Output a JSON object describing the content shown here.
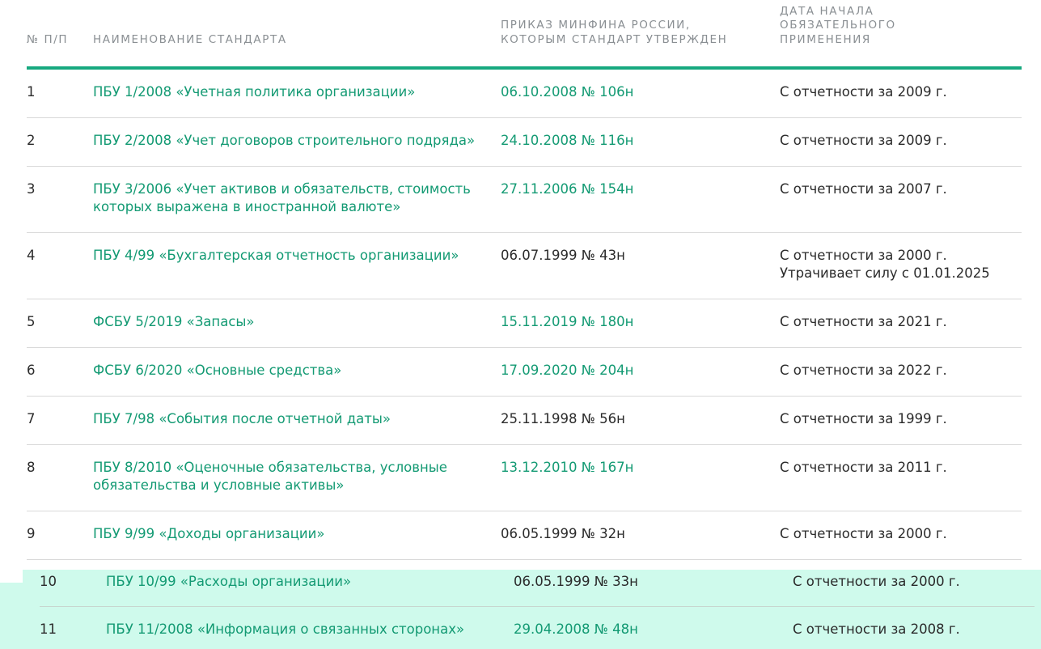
{
  "header": {
    "num": "№ П/П",
    "name": "НАИМЕНОВАНИЕ СТАНДАРТА",
    "order": "ПРИКАЗ МИНФИНА РОССИИ,\nКОТОРЫМ СТАНДАРТ УТВЕРЖДЕН",
    "date": "ДАТА НАЧАЛА\nОБЯЗАТЕЛЬНОГО\nПРИМЕНЕНИЯ"
  },
  "rows": [
    {
      "num": "1",
      "name": "ПБУ 1/2008 «Учетная политика организации»",
      "order": "06.10.2008 № 106н",
      "date": "С отчетности за 2009 г."
    },
    {
      "num": "2",
      "name": "ПБУ 2/2008 «Учет договоров строительного подряда»",
      "order": "24.10.2008 № 116н",
      "date": "С отчетности за 2009 г."
    },
    {
      "num": "3",
      "name": "ПБУ 3/2006 «Учет активов и обязательств, стоимость которых выражена в иностранной валюте»",
      "order": "27.11.2006 № 154н",
      "date": "С отчетности за 2007 г."
    },
    {
      "num": "4",
      "name": "ПБУ 4/99 «Бухгалтерская отчетность организации»",
      "order": "06.07.1999 № 43н",
      "date": "С отчетности за 2000 г.\nУтрачивает силу с 01.01.2025"
    },
    {
      "num": "5",
      "name": "ФСБУ 5/2019 «Запасы»",
      "order": "15.11.2019 № 180н",
      "date": "С отчетности за 2021 г."
    },
    {
      "num": "6",
      "name": "ФСБУ 6/2020 «Основные средства»",
      "order": "17.09.2020 № 204н",
      "date": "С отчетности за 2022 г."
    },
    {
      "num": "7",
      "name": "ПБУ 7/98 «События после отчетной даты»",
      "order": "25.11.1998 № 56н",
      "date": "С отчетности за 1999 г."
    },
    {
      "num": "8",
      "name": "ПБУ 8/2010 «Оценочные обязательства, условные обязательства и условные активы»",
      "order": "13.12.2010 № 167н",
      "date": "С отчетности за 2011 г."
    },
    {
      "num": "9",
      "name": "ПБУ 9/99 «Доходы организации»",
      "order": "06.05.1999 № 32н",
      "date": "С отчетности за 2000 г."
    }
  ],
  "overlay_rows": [
    {
      "num": "10",
      "name": "ПБУ 10/99 «Расходы организации»",
      "order": "06.05.1999 № 33н",
      "date": "С отчетности за 2000 г."
    },
    {
      "num": "11",
      "name": "ПБУ 11/2008 «Информация о связанных сторонах»",
      "order": "29.04.2008 № 48н",
      "date": "С отчетности за 2008 г."
    }
  ]
}
